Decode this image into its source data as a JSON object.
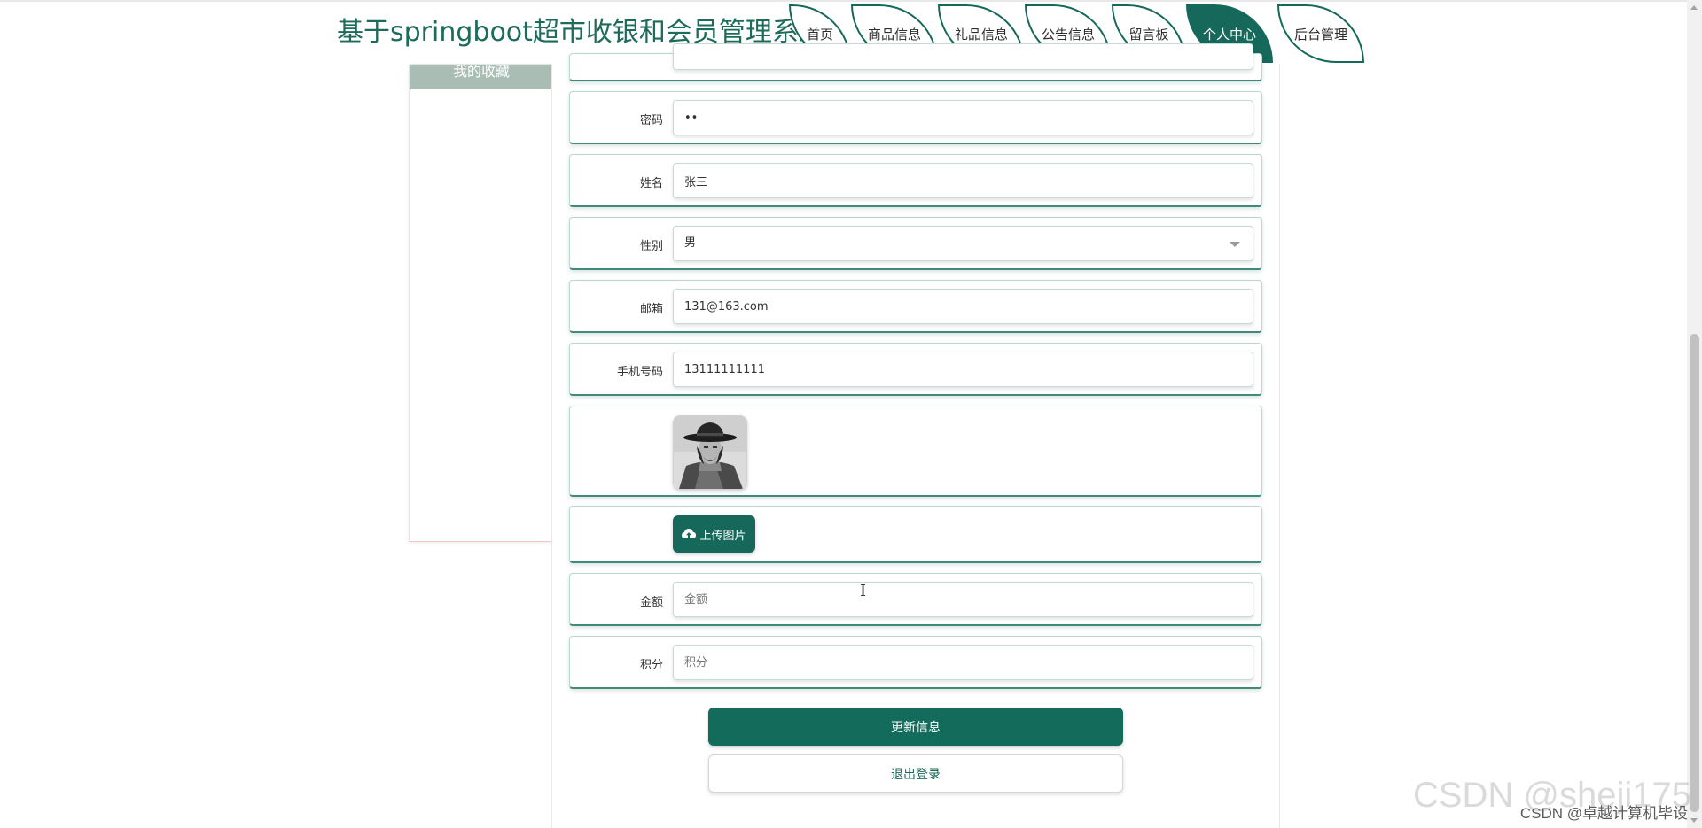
{
  "header": {
    "site_title": "基于springboot超市收银和会员管理系统",
    "nav": [
      {
        "label": "首页"
      },
      {
        "label": "商品信息"
      },
      {
        "label": "礼品信息"
      },
      {
        "label": "公告信息"
      },
      {
        "label": "留言板"
      },
      {
        "label": "个人中心",
        "active": true
      },
      {
        "label": "后台管理"
      }
    ]
  },
  "sidebar": {
    "heading": "我的收藏"
  },
  "form": {
    "password": {
      "label": "密码",
      "value": "••"
    },
    "name": {
      "label": "姓名",
      "value": "张三"
    },
    "gender": {
      "label": "性别",
      "value": "男"
    },
    "email": {
      "label": "邮箱",
      "value": "131@163.com"
    },
    "phone": {
      "label": "手机号码",
      "value": "13111111111"
    },
    "avatar": {
      "icon": "portrait-photo"
    },
    "upload": {
      "label": "上传图片",
      "icon": "cloud-upload-icon"
    },
    "amount": {
      "label": "金额",
      "placeholder": "金额"
    },
    "points": {
      "label": "积分",
      "placeholder": "积分"
    }
  },
  "buttons": {
    "update": "更新信息",
    "logout": "退出登录"
  },
  "watermark": {
    "large": "CSDN @sheji175",
    "small": "CSDN @卓越计算机毕设"
  },
  "colors": {
    "accent": "#16695a",
    "title": "#1d6b5a",
    "sidebar_head": "#a9bdb5"
  }
}
